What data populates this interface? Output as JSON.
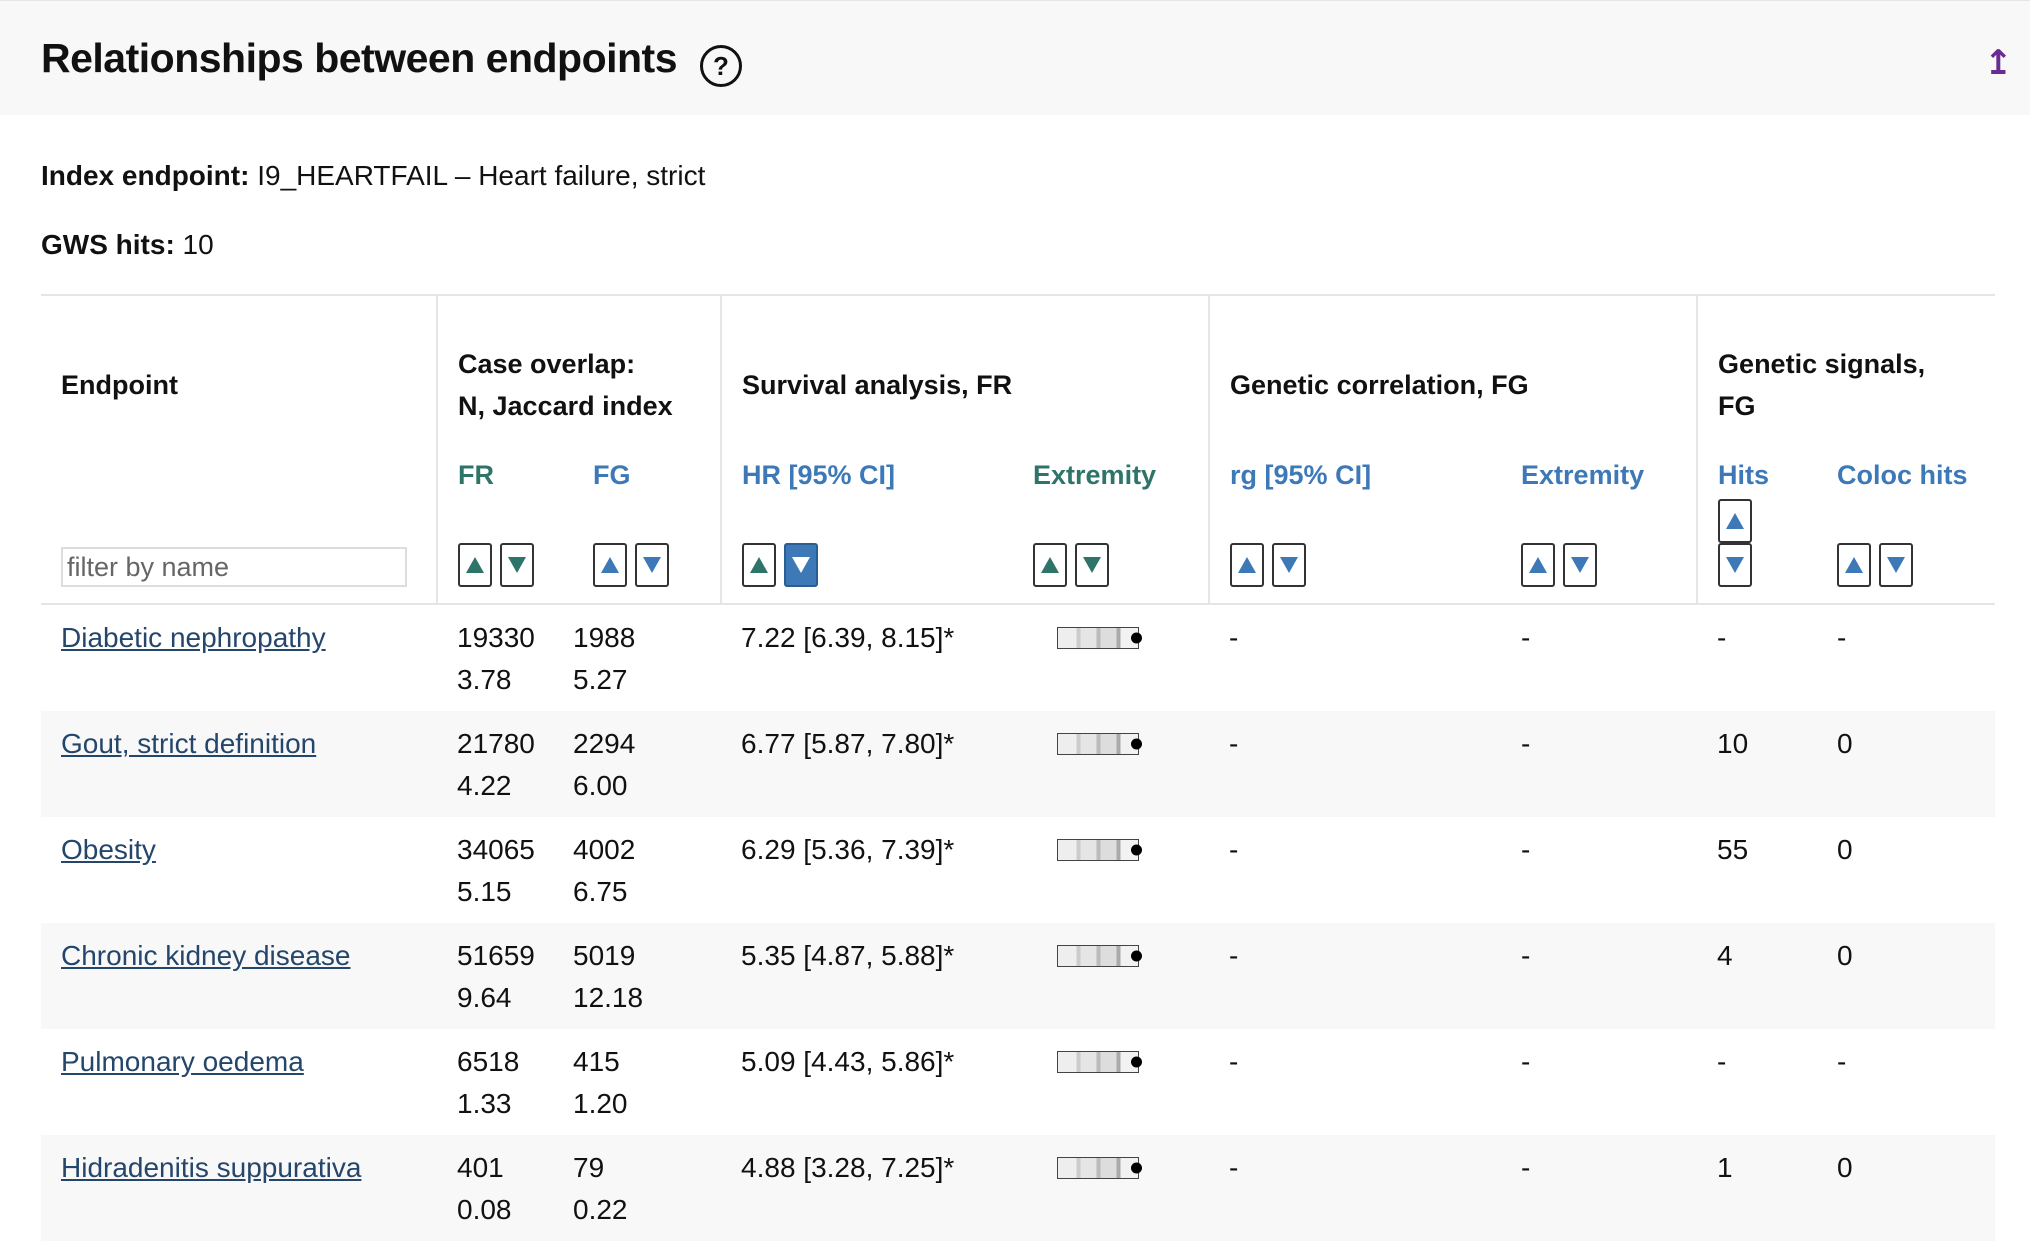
{
  "header": {
    "title": "Relationships between endpoints",
    "help_icon": "question-circle-icon",
    "top_icon": "arrow-up-bar-icon"
  },
  "info": {
    "index_label": "Index endpoint:",
    "index_value": "I9_HEARTFAIL – Heart failure, strict",
    "gws_label": "GWS hits:",
    "gws_value": "10"
  },
  "table": {
    "groups": {
      "endpoint": "Endpoint",
      "case_overlap_1": "Case overlap:",
      "case_overlap_2": "N, Jaccard index",
      "survival": "Survival analysis, FR",
      "genetic_corr": "Genetic correlation, FG",
      "genetic_signals_1": "Genetic signals,",
      "genetic_signals_2": "FG"
    },
    "subheaders": {
      "overlap_fr": "FR",
      "overlap_fg": "FG",
      "hr": "HR [95% CI]",
      "surv_extremity": "Extremity",
      "rg": "rg [95% CI]",
      "corr_extremity": "Extremity",
      "hits": "Hits",
      "coloc": "Coloc hits"
    },
    "filter_placeholder": "filter by name",
    "rows": [
      {
        "name": "Diabetic nephropathy",
        "fr_n": "19330",
        "fr_j": "3.78",
        "fg_n": "1988",
        "fg_j": "5.27",
        "hr": "7.22 [6.39, 8.15]*",
        "rg": "-",
        "rg_ext": "-",
        "hits": "-",
        "coloc": "-"
      },
      {
        "name": "Gout, strict definition",
        "fr_n": "21780",
        "fr_j": "4.22",
        "fg_n": "2294",
        "fg_j": "6.00",
        "hr": "6.77 [5.87, 7.80]*",
        "rg": "-",
        "rg_ext": "-",
        "hits": "10",
        "coloc": "0"
      },
      {
        "name": "Obesity",
        "fr_n": "34065",
        "fr_j": "5.15",
        "fg_n": "4002",
        "fg_j": "6.75",
        "hr": "6.29 [5.36, 7.39]*",
        "rg": "-",
        "rg_ext": "-",
        "hits": "55",
        "coloc": "0"
      },
      {
        "name": "Chronic kidney disease",
        "fr_n": "51659",
        "fr_j": "9.64",
        "fg_n": "5019",
        "fg_j": "12.18",
        "hr": "5.35 [4.87, 5.88]*",
        "rg": "-",
        "rg_ext": "-",
        "hits": "4",
        "coloc": "0"
      },
      {
        "name": "Pulmonary oedema",
        "fr_n": "6518",
        "fr_j": "1.33",
        "fg_n": "415",
        "fg_j": "1.20",
        "hr": "5.09 [4.43, 5.86]*",
        "rg": "-",
        "rg_ext": "-",
        "hits": "-",
        "coloc": "-"
      },
      {
        "name": "Hidradenitis suppurativa",
        "fr_n": "401",
        "fr_j": "0.08",
        "fg_n": "79",
        "fg_j": "0.22",
        "hr": "4.88 [3.28, 7.25]*",
        "rg": "-",
        "rg_ext": "-",
        "hits": "1",
        "coloc": "0"
      }
    ]
  }
}
